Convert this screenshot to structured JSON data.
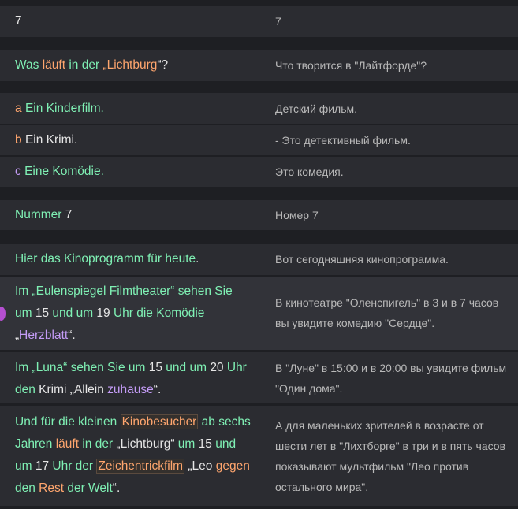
{
  "rows": [
    {
      "ru": "7",
      "de": [
        {
          "t": "7",
          "c": "w"
        }
      ]
    },
    {
      "ru": "Что творится в \"Лайтфорде\"?",
      "de": [
        {
          "t": "Was ",
          "c": "g"
        },
        {
          "t": "läuft",
          "c": "o"
        },
        {
          "t": " in der ",
          "c": "g"
        },
        {
          "t": "„Lichtburg",
          "c": "o"
        },
        {
          "t": "“?",
          "c": "w"
        }
      ]
    },
    {
      "ru": "Детский фильм.",
      "de": [
        {
          "t": "a ",
          "c": "o"
        },
        {
          "t": "Ein Kinderfilm.",
          "c": "g"
        }
      ]
    },
    {
      "ru": "- Это детективный фильм.",
      "de": [
        {
          "t": "b ",
          "c": "o"
        },
        {
          "t": "Ein Krimi.",
          "c": "w"
        }
      ]
    },
    {
      "ru": "Это комедия.",
      "de": [
        {
          "t": "c ",
          "c": "p"
        },
        {
          "t": "Eine Komödie.",
          "c": "g"
        }
      ]
    },
    {
      "ru": "Номер 7",
      "de": [
        {
          "t": "Nummer ",
          "c": "g"
        },
        {
          "t": "7",
          "c": "w"
        }
      ]
    },
    {
      "ru": "Вот сегодняшняя кинопрограмма.",
      "de": [
        {
          "t": "Hier das Kinoprogramm für heute",
          "c": "g"
        },
        {
          "t": ".",
          "c": "w"
        }
      ]
    },
    {
      "ru": "В кинотеатре \"Оленспигель\" в 3 и в 7 часов вы увидите комедию \"Сердце\".",
      "de": [
        {
          "t": "Im „Eulenspiegel Filmtheater“ ",
          "c": "g"
        },
        {
          "t": "sehen Sie",
          "c": "g"
        },
        {
          "t": " um ",
          "c": "g"
        },
        {
          "t": "15",
          "c": "w"
        },
        {
          "t": " und um ",
          "c": "g"
        },
        {
          "t": "19",
          "c": "w"
        },
        {
          "t": " Uhr die Komödie ",
          "c": "g"
        },
        {
          "t": "„",
          "c": "w"
        },
        {
          "t": "Herzblatt",
          "c": "p"
        },
        {
          "t": "“.",
          "c": "w"
        }
      ]
    },
    {
      "ru": "В \"Луне\" в 15:00 и в 20:00 вы увидите фильм \"Один дома\".",
      "de": [
        {
          "t": "Im „Luna“ ",
          "c": "g"
        },
        {
          "t": "sehen Sie",
          "c": "g"
        },
        {
          "t": " um ",
          "c": "g"
        },
        {
          "t": "15",
          "c": "w"
        },
        {
          "t": " und um ",
          "c": "g"
        },
        {
          "t": "20",
          "c": "w"
        },
        {
          "t": " Uhr den ",
          "c": "g"
        },
        {
          "t": "Krimi",
          "c": "w"
        },
        {
          "t": " „Allein ",
          "c": "w"
        },
        {
          "t": "zuhause",
          "c": "p"
        },
        {
          "t": "“.",
          "c": "w"
        }
      ]
    },
    {
      "ru": "А для маленьких зрителей в возрасте от шести лет в \"Лихтборге\" в три и в пять часов показывают мультфильм \"Лео против остального мира\".",
      "de": [
        {
          "t": "Und für die kleinen ",
          "c": "g"
        },
        {
          "t": "Kinobesucher",
          "c": "hl"
        },
        {
          "t": " ab sechs Jahren ",
          "c": "g"
        },
        {
          "t": "läuft",
          "c": "o"
        },
        {
          "t": " in der ",
          "c": "g"
        },
        {
          "t": "„Lichtburg“",
          "c": "w"
        },
        {
          "t": " um ",
          "c": "g"
        },
        {
          "t": "15",
          "c": "w"
        },
        {
          "t": " und um ",
          "c": "g"
        },
        {
          "t": "17",
          "c": "w"
        },
        {
          "t": " Uhr der ",
          "c": "g"
        },
        {
          "t": "Zeichentrickfilm",
          "c": "hl"
        },
        {
          "t": " „Leo ",
          "c": "w"
        },
        {
          "t": "gegen",
          "c": "o"
        },
        {
          "t": " den ",
          "c": "g"
        },
        {
          "t": "Rest",
          "c": "o"
        },
        {
          "t": " der Welt",
          "c": "g"
        },
        {
          "t": "“.",
          "c": "w"
        }
      ]
    }
  ]
}
